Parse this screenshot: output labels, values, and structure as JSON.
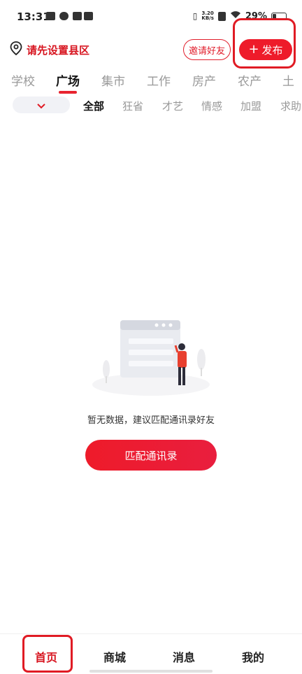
{
  "status_bar": {
    "time": "13:31",
    "net_speed_value": "3.20",
    "net_speed_unit": "KB/s",
    "battery_text": "29%",
    "battery_level": 0.29
  },
  "header": {
    "location_text": "请先设置县区",
    "invite_label": "邀请好友",
    "publish_label": "发布",
    "publish_icon": "plus-icon"
  },
  "tabs": [
    {
      "label": "学校"
    },
    {
      "label": "广场",
      "active": true
    },
    {
      "label": "集市"
    },
    {
      "label": "工作"
    },
    {
      "label": "房产"
    },
    {
      "label": "农产"
    },
    {
      "label": "土"
    }
  ],
  "subtabs": [
    {
      "label": "全部",
      "active": true
    },
    {
      "label": "狂省"
    },
    {
      "label": "才艺"
    },
    {
      "label": "情感"
    },
    {
      "label": "加盟"
    },
    {
      "label": "求助"
    }
  ],
  "empty_state": {
    "message": "暂无数据，建议匹配通讯录好友",
    "button_label": "匹配通讯录"
  },
  "bottom_nav": [
    {
      "label": "首页",
      "active": true
    },
    {
      "label": "商城"
    },
    {
      "label": "消息"
    },
    {
      "label": "我的"
    }
  ],
  "colors": {
    "accent": "#ee1b2a",
    "brand_red": "#d7141f"
  }
}
